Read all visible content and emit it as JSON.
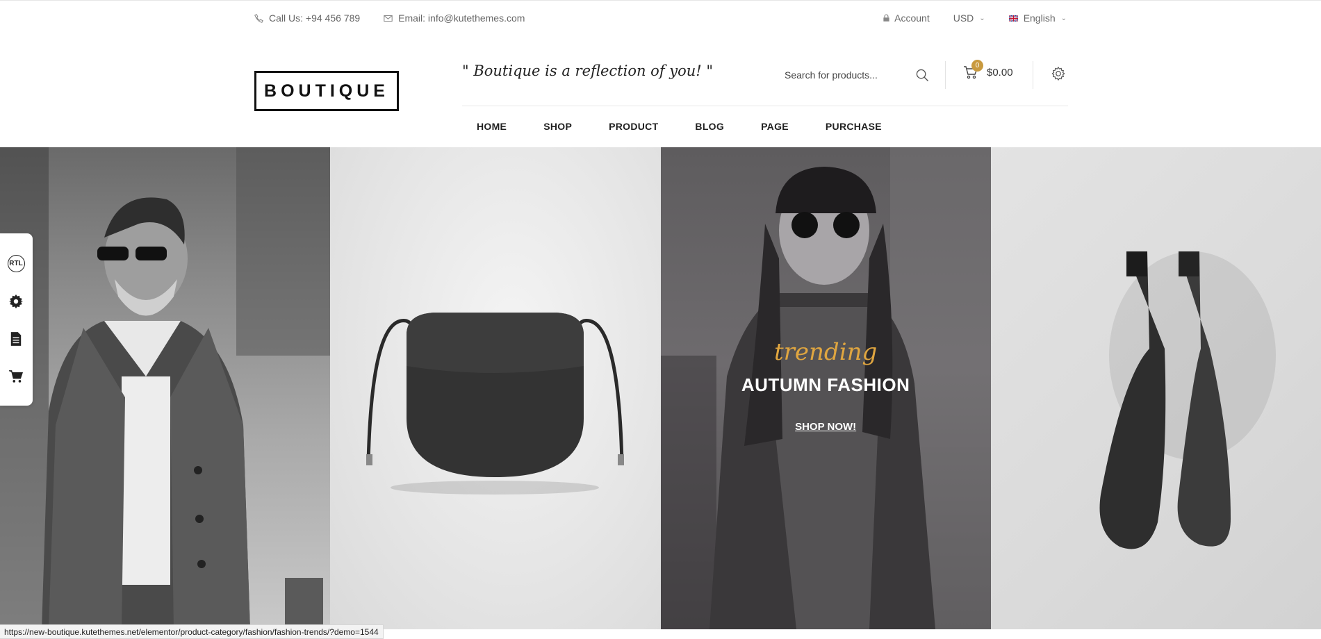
{
  "topbar": {
    "phone": "Call Us: +94 456 789",
    "email": "Email: info@kutethemes.com",
    "account": "Account",
    "currency": "USD",
    "language": "English"
  },
  "header": {
    "logo": "BOUTIQUE",
    "tagline": "\" Boutique is a reflection of you! \"",
    "search_placeholder": "Search for products...",
    "cart_count": "0",
    "cart_total": "$0.00"
  },
  "nav": {
    "items": [
      "HOME",
      "SHOP",
      "PRODUCT",
      "BLOG",
      "PAGE",
      "PURCHASE"
    ]
  },
  "hero": {
    "panel3": {
      "script": "trending",
      "title": "AUTUMN FASHION",
      "cta": "SHOP NOW!"
    }
  },
  "sidebar": {
    "rtl_label": "RTL"
  },
  "status_url": "https://new-boutique.kutethemes.net/elementor/product-category/fashion/fashion-trends/?demo=1544",
  "colors": {
    "accent_gold": "#c99a3f",
    "trending_gold": "#e0a640"
  }
}
